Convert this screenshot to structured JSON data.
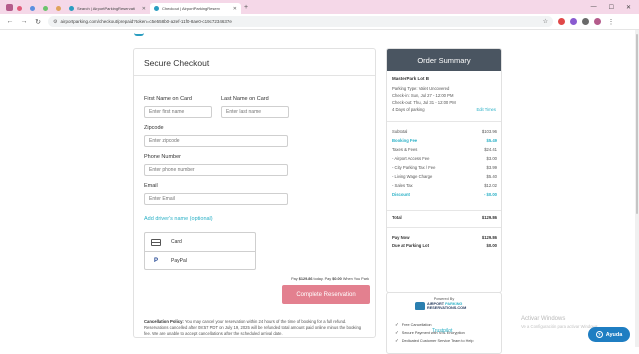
{
  "browser": {
    "tabs": [
      {
        "title": "Search | AirportParkingReservati",
        "active": false
      },
      {
        "title": "Checkout | AirportParkingReserv",
        "active": true
      }
    ],
    "new_tab": "+",
    "url": "airportparking.com/checkout/prepaid?token=c5e558b0-a2ef-11f0-8ae0-c19c7234637e",
    "window_controls": [
      "—",
      "☐",
      "✕"
    ]
  },
  "checkout": {
    "title": "Secure Checkout",
    "first_name_label": "First Name on Card",
    "first_name_placeholder": "Enter first name",
    "last_name_label": "Last Name on Card",
    "last_name_placeholder": "Enter last name",
    "zipcode_label": "Zipcode",
    "zipcode_placeholder": "Enter zipcode",
    "phone_label": "Phone Number",
    "phone_placeholder": "Enter phone number",
    "email_label": "Email",
    "email_placeholder": "Enter Email",
    "add_driver": "Add driver's name (optional)",
    "payment_options": [
      {
        "label": "Card",
        "icon": "card-icon"
      },
      {
        "label": "PayPal",
        "icon": "paypal-icon"
      }
    ],
    "pay_note_prefix": "Pay ",
    "pay_today": "$129.86",
    "pay_note_mid": " today. Pay ",
    "pay_later": "$0.00",
    "pay_note_suffix": " When You Park",
    "complete_button": "Complete Reservation",
    "policy_title": "Cancellation Policy:",
    "policy_text": "You may cancel your reservation within 24 hours of the time of booking for a full refund. Reservations cancelled after 08:57 PDT on July 19, 2025 will be refunded total amount paid online minus the booking fee. We are unable to accept cancellations after the scheduled arrival date."
  },
  "summary": {
    "title": "Order Summary",
    "lot_name": "MasterPark Lot B",
    "parking_type": "Parking Type: Valet Uncovered",
    "check_in": "Check-in: Sun, Jul 27 - 12:00 PM",
    "check_out": "Check-out: Thu, Jul 31 - 12:00 PM",
    "days": "4 Days of parking",
    "edit_times": "Edit Times",
    "lines": [
      {
        "label": "Subtotal",
        "value": "$103.96",
        "style": "normal"
      },
      {
        "label": "Booking Fee",
        "value": "$5.49",
        "style": "teal"
      },
      {
        "label": "Taxes & Fees",
        "value": "$24.41",
        "style": "normal"
      },
      {
        "label": "- Airport Access Fee",
        "value": "$3.00",
        "style": "normal"
      },
      {
        "label": "- City Parking Tax / Fee",
        "value": "$3.99",
        "style": "normal"
      },
      {
        "label": "- Living Wage Charge",
        "value": "$5.40",
        "style": "normal"
      },
      {
        "label": "- Sales Tax",
        "value": "$12.02",
        "style": "normal"
      },
      {
        "label": "Discount",
        "value": "- $0.00",
        "style": "teal"
      }
    ],
    "total_label": "Total",
    "total_value": "$129.86",
    "pay_now_label": "Pay Now",
    "pay_now_value": "$129.86",
    "due_label": "Due at Parking Lot",
    "due_value": "$0.00"
  },
  "trust": {
    "powered_by": "Powered By",
    "brand_line1": "AIRPORT",
    "brand_line1b": "PARKING",
    "brand_line2": "RESERVATIONS.COM",
    "features": [
      "Free Cancellation",
      "Secure Payment with SSL Encryption",
      "Dedicated Customer Service Team to Help"
    ],
    "trustpilot": "Trustpilot"
  },
  "os": {
    "activate_title": "Activar Windows",
    "activate_sub": "Ve a Configuración para activar Windows.",
    "help_button": "Ayuda"
  },
  "colors": {
    "teal": "#2ab0c6",
    "button": "#e3808f",
    "summary_header": "#4a5561",
    "help": "#1f7ec2"
  }
}
